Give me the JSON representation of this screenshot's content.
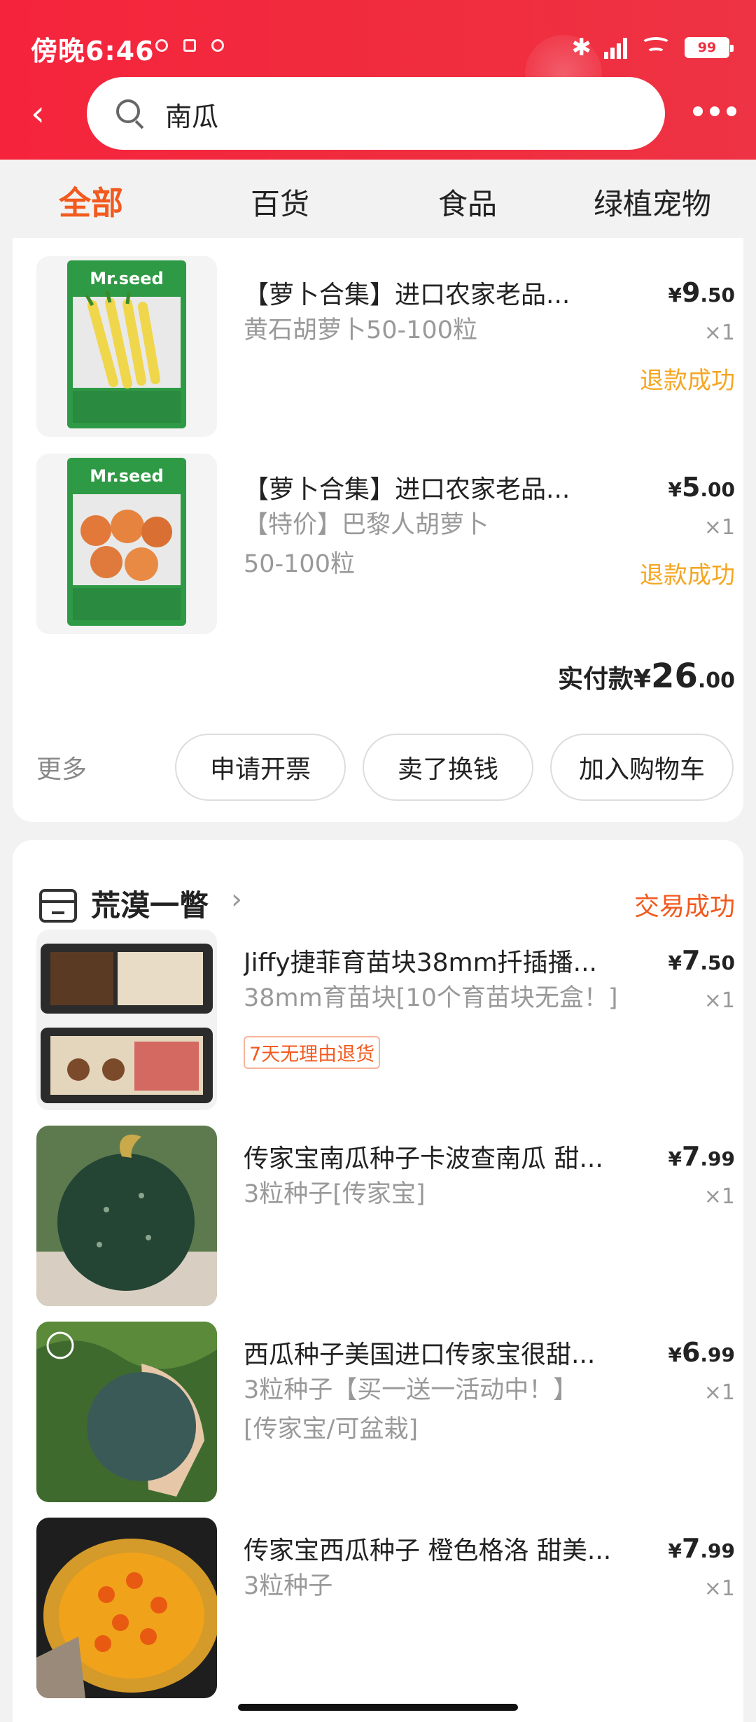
{
  "status_bar": {
    "time": "傍晚6:46",
    "battery": "99"
  },
  "search": {
    "query": "南瓜"
  },
  "tabs": [
    {
      "label": "全部",
      "active": true
    },
    {
      "label": "百货",
      "active": false
    },
    {
      "label": "食品",
      "active": false
    },
    {
      "label": "绿植宠物",
      "active": false
    }
  ],
  "order1": {
    "items": [
      {
        "title": "【萝卜合集】进口农家老品...",
        "spec": "黄石胡萝卜50-100粒",
        "price_int": "9",
        "price_dec": ".50",
        "qty": "×1",
        "status": "退款成功"
      },
      {
        "title": "【萝卜合集】进口农家老品...",
        "spec_line1": "【特价】巴黎人胡萝卜",
        "spec_line2": "50-100粒",
        "price_int": "5",
        "price_dec": ".00",
        "qty": "×1",
        "status": "退款成功"
      }
    ],
    "paid_label": "实付款",
    "currency": "¥",
    "paid_int": "26",
    "paid_dec": ".00",
    "more_label": "更多",
    "buttons": [
      "申请开票",
      "卖了换钱",
      "加入购物车"
    ]
  },
  "order2": {
    "shop_name": "荒漠一瞥",
    "status": "交易成功",
    "items": [
      {
        "title": "Jiffy捷菲育苗块38mm扦插播...",
        "spec": "38mm育苗块[10个育苗块无盒！]",
        "tag": "7天无理由退货",
        "price_int": "7",
        "price_dec": ".50",
        "qty": "×1"
      },
      {
        "title": "传家宝南瓜种子卡波查南瓜 甜...",
        "spec": "3粒种子[传家宝]",
        "price_int": "7",
        "price_dec": ".99",
        "qty": "×1"
      },
      {
        "title": "西瓜种子美国进口传家宝很甜...",
        "spec_line1": "3粒种子【买一送一活动中！】",
        "spec_line2": "[传家宝/可盆栽]",
        "price_int": "6",
        "price_dec": ".99",
        "qty": "×1"
      },
      {
        "title": "传家宝西瓜种子 橙色格洛 甜美...",
        "spec": "3粒种子",
        "price_int": "7",
        "price_dec": ".99",
        "qty": "×1"
      }
    ]
  },
  "colors": {
    "brand_red": "#f02d3f",
    "accent_orange": "#f25a1e",
    "refund_yellow": "#f5a623"
  }
}
